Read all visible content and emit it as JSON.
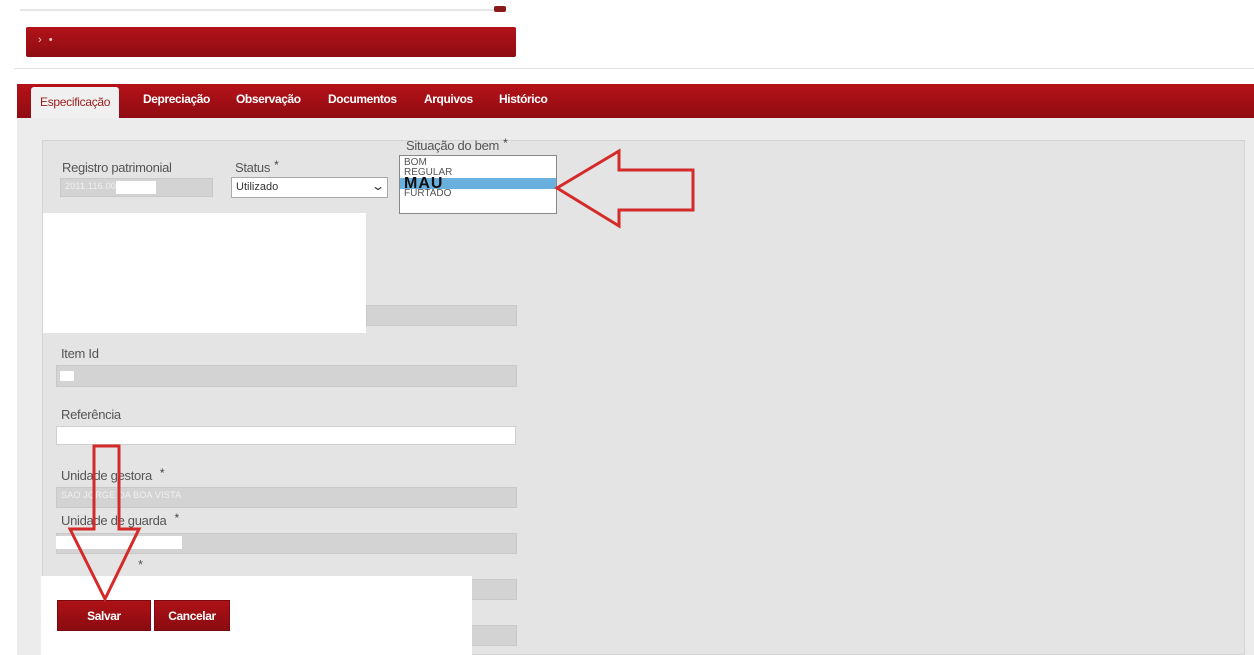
{
  "header": {
    "arrows": "› •"
  },
  "tabs": [
    {
      "label": "Especificação"
    },
    {
      "label": "Depreciação"
    },
    {
      "label": "Observação"
    },
    {
      "label": "Documentos"
    },
    {
      "label": "Arquivos"
    },
    {
      "label": "Histórico"
    }
  ],
  "form": {
    "registro": {
      "label": "Registro patrimonial",
      "value": "2011.116.000"
    },
    "status": {
      "label": "Status",
      "required": "*",
      "value": "Utilizado"
    },
    "situacao": {
      "label": "Situação do bem",
      "required": "*",
      "options": [
        "BOM",
        "REGULAR",
        "MAU",
        "FURTADO"
      ],
      "highlighted": "MAU"
    },
    "item_id": {
      "label": "Item Id"
    },
    "referencia": {
      "label": "Referência",
      "value": ""
    },
    "unidade_gestora": {
      "label": "Unidade gestora",
      "required": "*",
      "value": "SAO JORGE DA BOA VISTA"
    },
    "unidade_guarda": {
      "label": "Unidade de guarda",
      "required": "*"
    },
    "localizacao": {
      "required": "*"
    }
  },
  "footer": {
    "save_label": "Salvar",
    "cancel_label": "Cancelar"
  },
  "annotations": {
    "arrow_color": "#d42a2a"
  }
}
